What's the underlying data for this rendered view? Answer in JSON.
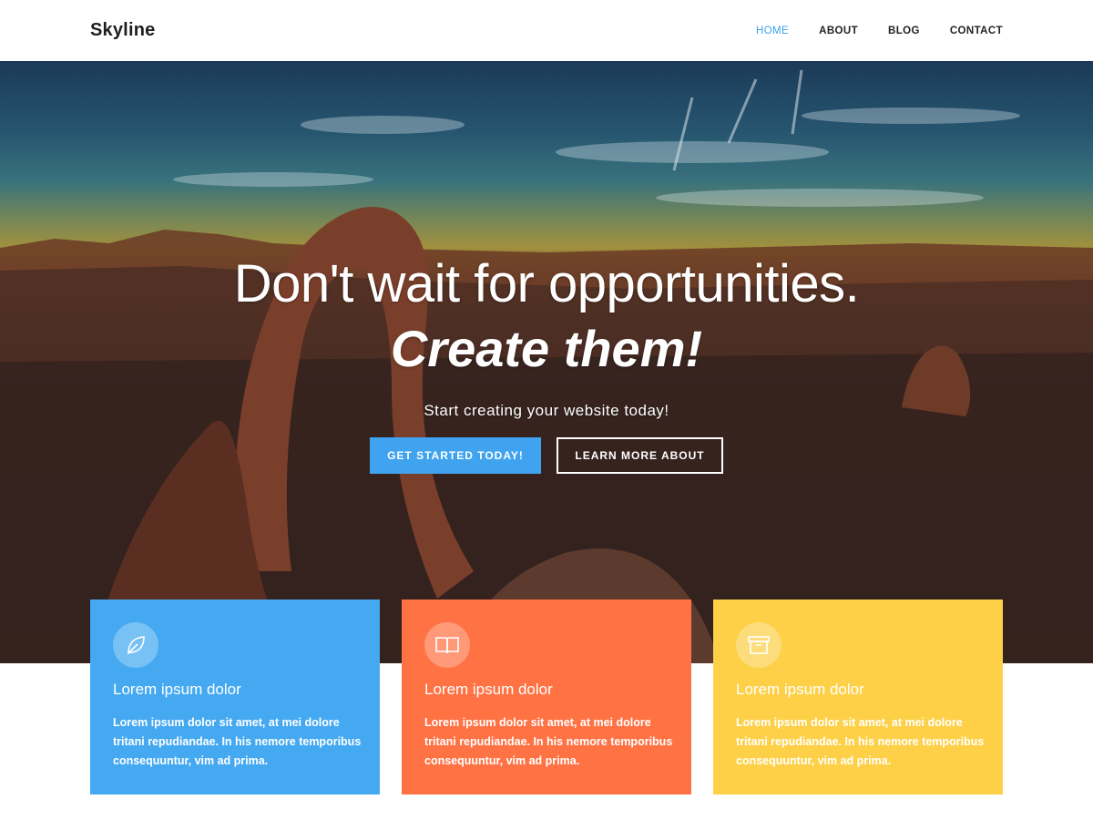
{
  "site": {
    "logo": "Skyline"
  },
  "nav": {
    "items": [
      {
        "label": "HOME",
        "active": true
      },
      {
        "label": "ABOUT",
        "active": false
      },
      {
        "label": "BLOG",
        "active": false
      },
      {
        "label": "CONTACT",
        "active": false
      }
    ]
  },
  "hero": {
    "title_line1": "Don't wait for opportunities.",
    "title_line2": "Create them!",
    "subtitle": "Start creating your website today!",
    "primary_button": "GET STARTED TODAY!",
    "secondary_button": "LEARN MORE ABOUT"
  },
  "features": [
    {
      "icon": "leaf-icon",
      "color": "#45a9f1",
      "title": "Lorem ipsum dolor",
      "text": "Lorem ipsum dolor sit amet, at mei dolore tritani repudiandae. In his nemore temporibus consequuntur, vim ad prima."
    },
    {
      "icon": "book-icon",
      "color": "#ff7244",
      "title": "Lorem ipsum dolor",
      "text": "Lorem ipsum dolor sit amet, at mei dolore tritani repudiandae. In his nemore temporibus consequuntur, vim ad prima."
    },
    {
      "icon": "archive-icon",
      "color": "#fdd048",
      "title": "Lorem ipsum dolor",
      "text": "Lorem ipsum dolor sit amet, at mei dolore tritani repudiandae. In his nemore temporibus consequuntur, vim ad prima."
    }
  ],
  "colors": {
    "nav_active": "#3aa2e8",
    "primary_button": "#3fa3ef"
  }
}
